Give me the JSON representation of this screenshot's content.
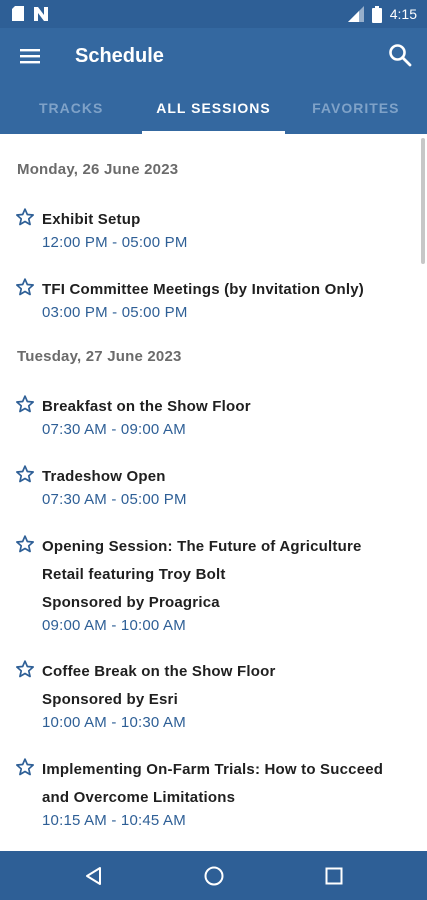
{
  "status": {
    "time": "4:15"
  },
  "appbar": {
    "title": "Schedule"
  },
  "tabs": [
    {
      "label": "TRACKS",
      "active": false
    },
    {
      "label": "ALL SESSIONS",
      "active": true
    },
    {
      "label": "FAVORITES",
      "active": false
    }
  ],
  "days": [
    {
      "date": "Monday, 26 June 2023",
      "sessions": [
        {
          "lines": [
            "Exhibit Setup"
          ],
          "time": "12:00 PM - 05:00 PM"
        },
        {
          "lines": [
            "TFI Committee Meetings (by Invitation Only)"
          ],
          "time": "03:00 PM - 05:00 PM"
        }
      ]
    },
    {
      "date": "Tuesday, 27 June 2023",
      "sessions": [
        {
          "lines": [
            "Breakfast on the Show Floor"
          ],
          "time": "07:30 AM - 09:00 AM"
        },
        {
          "lines": [
            "Tradeshow Open"
          ],
          "time": "07:30 AM - 05:00 PM"
        },
        {
          "lines": [
            "Opening Session: The Future of Agriculture",
            "Retail featuring Troy Bolt",
            "Sponsored by Proagrica"
          ],
          "time": "09:00 AM - 10:00 AM"
        },
        {
          "lines": [
            "Coffee Break on the Show Floor",
            "Sponsored by Esri"
          ],
          "time": "10:00 AM - 10:30 AM"
        },
        {
          "lines": [
            "Implementing On-Farm Trials: How to Succeed",
            "and Overcome Limitations"
          ],
          "time": "10:15 AM - 10:45 AM"
        }
      ]
    }
  ],
  "icons": {
    "status_left": [
      "sd-card-icon",
      "n-notification-icon"
    ],
    "status_right": [
      "signal-icon",
      "battery-icon"
    ],
    "appbar": [
      "menu-icon",
      "search-icon"
    ],
    "navbar": [
      "back-icon",
      "home-icon",
      "recents-icon"
    ]
  },
  "colors": {
    "primary": "#3468a0",
    "primary_dark": "#2e5f96",
    "time_text": "#2e5f96",
    "tab_inactive": "#7fa2c8"
  }
}
